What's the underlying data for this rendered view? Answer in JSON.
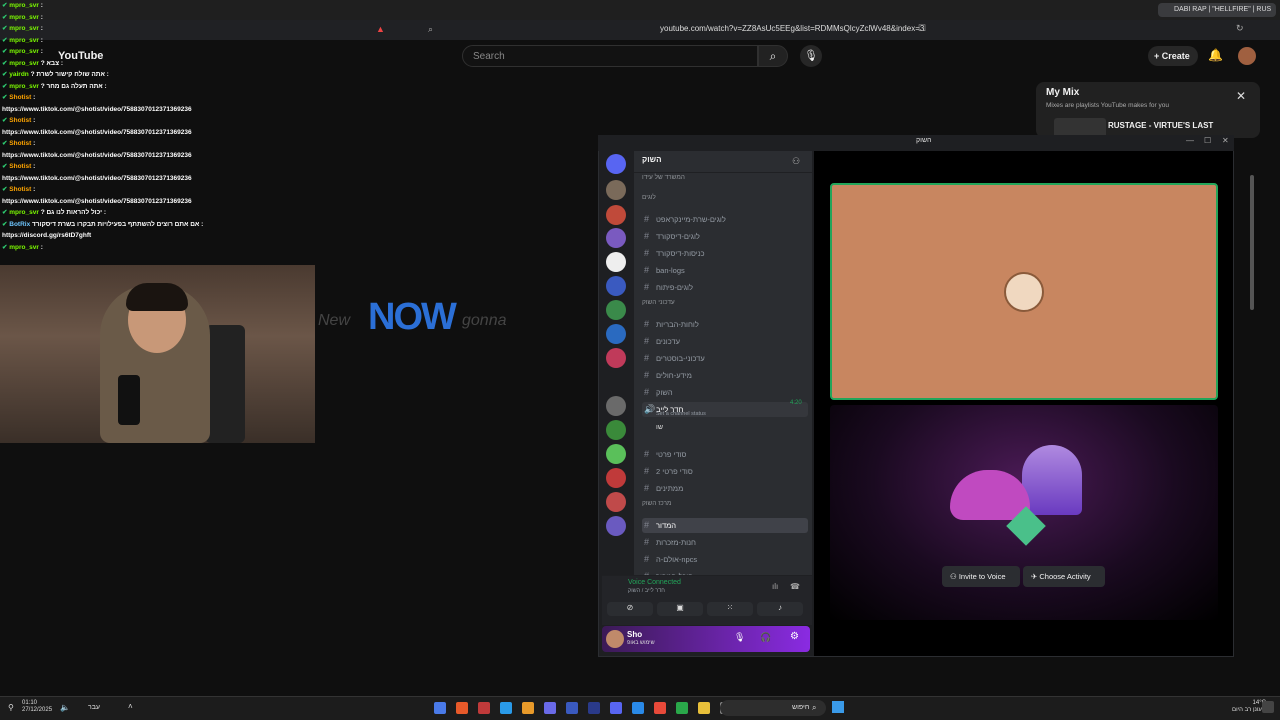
{
  "browser": {
    "url": "youtube.com/watch?v=ZZ8AsUc5EEg&list=RDMMsQlcyZclWv48&index=3",
    "tab_title": "DABI RAP | \"HELLFIRE\" | RUS"
  },
  "youtube": {
    "logo": "YouTube",
    "search_placeholder": "Search",
    "create_label": "Create",
    "mymix": {
      "title": "My Mix",
      "subtitle": "Mixes are playlists YouTube makes for you",
      "item": "RUSTAGE - VIRTUE'S LAST"
    },
    "video_word": "NOW"
  },
  "chat": [
    {
      "user": "mpro_svr",
      "text": ":",
      "color": "green"
    },
    {
      "user": "mpro_svr",
      "text": ":",
      "color": "green"
    },
    {
      "user": "mpro_svr",
      "text": ":",
      "color": "green"
    },
    {
      "user": "mpro_svr",
      "text": ":",
      "color": "green"
    },
    {
      "user": "mpro_svr",
      "text": ":",
      "color": "green"
    },
    {
      "user": "mpro_svr",
      "text": "? צבא :",
      "color": "green"
    },
    {
      "user": "yairdn",
      "text": "? אתה שולח קישור לשרת :",
      "color": "green"
    },
    {
      "user": "mpro_svr",
      "text": "? אתה תעלה גם מחר :",
      "color": "green"
    },
    {
      "user": "Shotist",
      "text": ":",
      "color": "orange"
    },
    {
      "user": "",
      "text": "https://www.tiktok.com/@shotist/video/7588307012371369236",
      "color": "white"
    },
    {
      "user": "Shotist",
      "text": ":",
      "color": "orange"
    },
    {
      "user": "",
      "text": "https://www.tiktok.com/@shotist/video/7588307012371369236",
      "color": "white"
    },
    {
      "user": "Shotist",
      "text": ":",
      "color": "orange"
    },
    {
      "user": "",
      "text": "https://www.tiktok.com/@shotist/video/7588307012371369236",
      "color": "white"
    },
    {
      "user": "Shotist",
      "text": ":",
      "color": "orange"
    },
    {
      "user": "",
      "text": "https://www.tiktok.com/@shotist/video/7588307012371369236",
      "color": "white"
    },
    {
      "user": "Shotist",
      "text": ":",
      "color": "orange"
    },
    {
      "user": "",
      "text": "https://www.tiktok.com/@shotist/video/7588307012371369236",
      "color": "white"
    },
    {
      "user": "mpro_svr",
      "text": "? יכול להראות לנו גם :",
      "color": "green"
    },
    {
      "user": "BotRix",
      "text": "אם אתם רוצים להשתתף בפעילויות תבקרו בשרת דיסקורד :",
      "color": "blue"
    },
    {
      "user": "",
      "text": "https://discord.gg/rs6tD7ghft",
      "color": "white"
    },
    {
      "user": "mpro_svr",
      "text": ":",
      "color": "green"
    }
  ],
  "discord": {
    "window_title": "השוק",
    "server_name": "השוק",
    "channels": [
      {
        "type": "cat",
        "label": "המשרד של עידו"
      },
      {
        "type": "cat",
        "label": "לוגים"
      },
      {
        "type": "ch",
        "label": "לוגים-שרת-מיינקראפט"
      },
      {
        "type": "ch",
        "label": "לוגים-דיסקורד"
      },
      {
        "type": "ch",
        "label": "כניסות-דיסקורד"
      },
      {
        "type": "ch",
        "label": "ban-logs"
      },
      {
        "type": "ch",
        "label": "לוגים-פיתוח"
      },
      {
        "type": "cat",
        "label": "עדכוני השוק"
      },
      {
        "type": "ch",
        "label": "לוחות-הבריות"
      },
      {
        "type": "ch",
        "label": "עדכונים"
      },
      {
        "type": "ch",
        "label": "עדכוני-בוסטרים"
      },
      {
        "type": "ch",
        "label": "מידע-חולים"
      },
      {
        "type": "ch",
        "label": "השוק"
      },
      {
        "type": "voice",
        "label": "חדר לייב"
      },
      {
        "type": "ch",
        "label": "סודי פרטי"
      },
      {
        "type": "ch",
        "label": "סודי פרטי 2"
      },
      {
        "type": "ch",
        "label": "ממתינים"
      },
      {
        "type": "cat",
        "label": "מרכז השוק"
      },
      {
        "type": "sel",
        "label": "המדור"
      },
      {
        "type": "ch",
        "label": "חנות-מזכרות"
      },
      {
        "type": "ch",
        "label": "אולם-ה-npcs"
      },
      {
        "type": "ch",
        "label": "היכל-הגיבור"
      }
    ],
    "voice_status": "Set a channel status",
    "voice_user": "שו",
    "voice_time": "4:20",
    "voice_connected": "Voice Connected",
    "voice_sub": "חדר לייב / השוק",
    "user_name": "Sho",
    "user_status": "שימוש באופ",
    "invite_label": "Invite to Voice",
    "activity_label": "Choose Activity"
  },
  "taskbar": {
    "time": "01:10",
    "date": "27/12/2025",
    "lang": "עבר",
    "search_label": "חיפוש",
    "temp": "14°C",
    "weather": "מעונן רב היום"
  },
  "colors": {
    "green": "#7cfc00",
    "orange": "#ffa500",
    "white": "#ffffff",
    "blue": "#6ec6ff",
    "discord_green": "#23a55a"
  }
}
